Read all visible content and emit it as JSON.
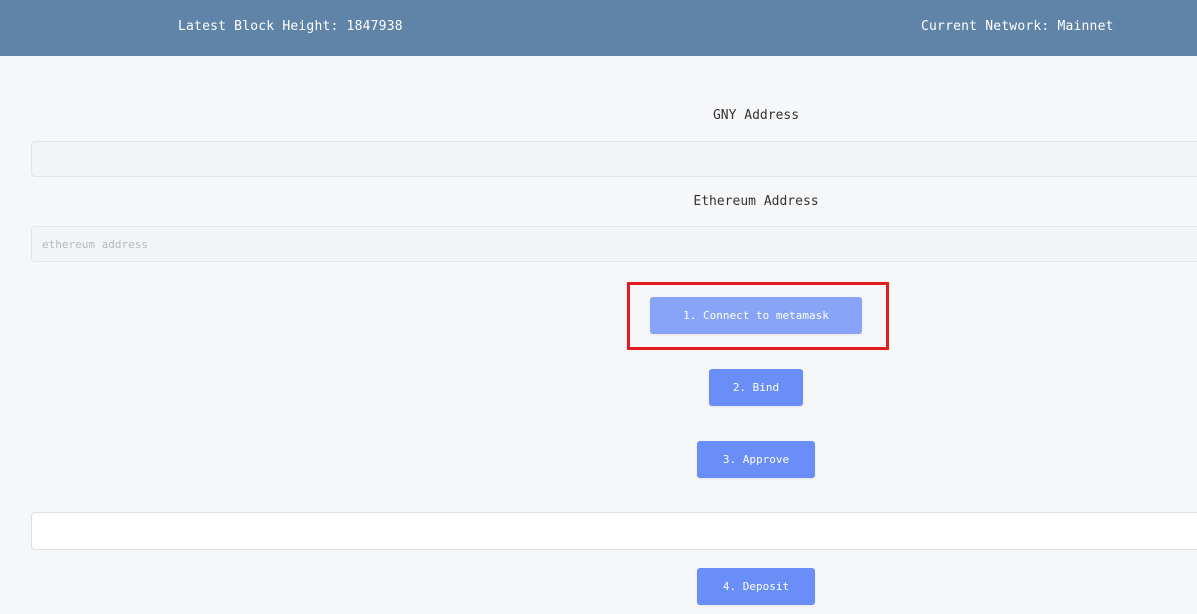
{
  "header": {
    "block_height": "Latest Block Height: 1847938",
    "network": "Current Network: Mainnet"
  },
  "form": {
    "gny_label": "GNY Address",
    "gny_value": "",
    "ethereum_label": "Ethereum Address",
    "ethereum_placeholder": "ethereum address",
    "amount_value": ""
  },
  "buttons": {
    "connect": "1. Connect to metamask",
    "bind": "2. Bind",
    "approve": "3. Approve",
    "deposit": "4. Deposit"
  },
  "colors": {
    "header_bg": "#5f84a7",
    "button_primary": "#6a8ef7",
    "button_connect": "#88a4f7",
    "highlight_border": "#e51c1c"
  }
}
